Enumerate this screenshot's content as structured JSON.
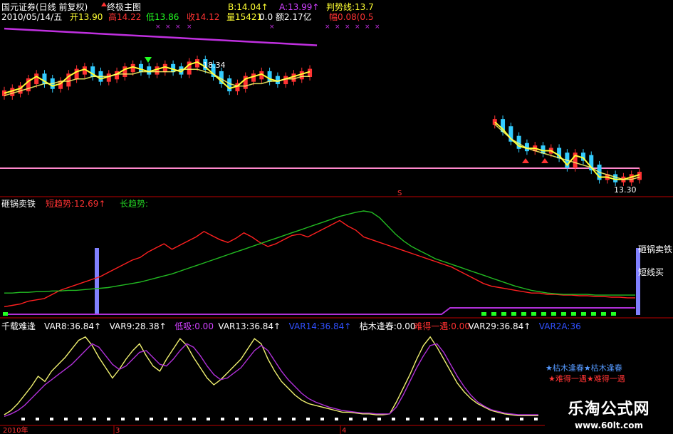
{
  "header": {
    "stock_name": "国元证券(日线 前复权)",
    "date": "2010/05/14/五",
    "main_indicator": "终极主图",
    "b_label": "B:14.04↑",
    "a_label": "A:13.99↑",
    "trend_label": "判势线:13.7",
    "open": "开13.90",
    "high": "高14.22",
    "low": "低13.86",
    "close": "收14.12",
    "volume": "量15421",
    "amount": "0.0 额2.17亿",
    "change": "幅0.08(0.5"
  },
  "colors": {
    "background": "#000000",
    "ma_yellow": "#ffff33",
    "trend_purple": "#c030e0",
    "up_candle": "#ff3333",
    "down_candle": "#33ccff",
    "line_red": "#ff2020",
    "line_green": "#22bb22",
    "line_magenta": "#b030d8",
    "line_yellow": "#f0f070",
    "bar_blue": "#8080ff",
    "square_green": "#22ff22",
    "ref_line": "#ff88cc"
  },
  "price_panel": {
    "high_annotation": "18.34",
    "low_annotation": "13.30",
    "s_marker": "S"
  },
  "panel2": {
    "title": "砸锅卖铁",
    "short_label": "短趋势:12.69↑",
    "long_label": "长趋势:",
    "right_label_1": "砸锅卖铁",
    "right_label_2": "短线买"
  },
  "panel3": {
    "title": "千载难逢",
    "items": [
      {
        "text": "VAR8:36.84↑",
        "color": "#ffffff"
      },
      {
        "text": "VAR9:28.38↑",
        "color": "#ffffff"
      },
      {
        "text": "低吸:0.00",
        "color": "#d040ff"
      },
      {
        "text": "VAR13:36.84↑",
        "color": "#ffffff"
      },
      {
        "text": "VAR14:36.84↑",
        "color": "#3050ff"
      },
      {
        "text": "枯木逢春:0.00",
        "color": "#ffffff"
      },
      {
        "text": "难得一遇:0.00",
        "color": "#ff3030"
      },
      {
        "text": "VAR29:36.84↑",
        "color": "#ffffff"
      },
      {
        "text": "VAR2A:36",
        "color": "#3050ff"
      }
    ],
    "signal_1": "★枯木逢春★枯木逢春",
    "signal_2": "★难得一遇★难得一遇"
  },
  "time_axis": {
    "labels": [
      "2010年",
      "3",
      "4"
    ]
  },
  "watermark": {
    "name": "乐淘公式网",
    "url": "www.60lt.com"
  },
  "chart_data": [
    {
      "type": "line",
      "panel": "price",
      "title": "终极主图",
      "x": [
        0,
        1,
        2,
        3,
        4,
        5,
        6,
        7,
        8,
        9,
        10,
        11,
        12,
        13,
        14,
        15,
        16,
        17,
        18,
        19,
        20,
        21,
        22,
        23,
        24,
        25,
        26,
        27,
        28,
        29,
        30,
        31,
        32,
        33,
        34,
        35,
        36,
        37,
        38,
        39,
        40,
        41,
        42,
        43,
        44,
        45,
        46,
        47,
        48,
        49,
        50,
        51,
        52,
        53,
        54,
        55,
        56,
        57,
        58,
        59,
        60,
        61,
        62,
        63,
        64,
        65,
        66,
        67,
        68,
        69,
        70,
        71,
        72,
        73,
        74,
        75,
        76,
        77,
        78,
        79
      ],
      "series": [
        {
          "name": "B",
          "values": [
            17.2,
            17.3,
            17.4,
            17.7,
            17.9,
            17.7,
            17.5,
            17.6,
            17.9,
            18.1,
            18.2,
            18.0,
            17.8,
            17.9,
            18.0,
            18.2,
            18.3,
            18.2,
            18.1,
            18.2,
            18.3,
            18.2,
            18.1,
            18.4,
            18.5,
            18.3,
            18.0,
            17.7,
            17.4,
            17.5,
            17.8,
            17.9,
            18.0,
            17.8,
            17.7,
            17.8,
            17.9,
            18.0,
            18.1,
            null,
            null,
            null,
            null,
            null,
            null,
            null,
            null,
            null,
            null,
            null,
            null,
            null,
            null,
            null,
            null,
            null,
            null,
            null,
            null,
            null,
            null,
            16.0,
            15.7,
            15.3,
            15.0,
            14.9,
            14.9,
            14.8,
            14.8,
            14.6,
            14.2,
            14.6,
            14.5,
            14.1,
            13.7,
            13.7,
            13.6,
            13.6,
            13.7,
            13.8
          ]
        },
        {
          "name": "判势线",
          "values": [
            17.1,
            17.2,
            17.3,
            17.4,
            17.5,
            17.6,
            17.6,
            17.7,
            17.7,
            17.8,
            17.8,
            17.9,
            17.9,
            17.9,
            18.0,
            18.0,
            18.0,
            18.1,
            18.1,
            18.1,
            18.1,
            18.1,
            18.2,
            18.2,
            18.2,
            18.1,
            18.0,
            17.8,
            17.6,
            17.5,
            17.5,
            17.6,
            17.6,
            17.7,
            17.7,
            17.8,
            17.8,
            17.9,
            17.9,
            null,
            null,
            null,
            null,
            null,
            null,
            null,
            null,
            null,
            null,
            null,
            null,
            null,
            null,
            null,
            null,
            null,
            null,
            null,
            null,
            null,
            null,
            15.9,
            15.6,
            15.3,
            15.1,
            14.9,
            14.8,
            14.7,
            14.6,
            14.5,
            14.4,
            14.3,
            14.2,
            14.1,
            13.9,
            13.8,
            13.7,
            13.6,
            13.6,
            13.7
          ]
        }
      ],
      "trend_line": {
        "start": 19.9,
        "end": 19.2
      }
    },
    {
      "type": "line",
      "panel": "砸锅卖铁",
      "x": [
        0,
        1,
        2,
        3,
        4,
        5,
        6,
        7,
        8,
        9,
        10,
        11,
        12,
        13,
        14,
        15,
        16,
        17,
        18,
        19,
        20,
        21,
        22,
        23,
        24,
        25,
        26,
        27,
        28,
        29,
        30,
        31,
        32,
        33,
        34,
        35,
        36,
        37,
        38,
        39,
        40,
        41,
        42,
        43,
        44,
        45,
        46,
        47,
        48,
        49,
        50,
        51,
        52,
        53,
        54,
        55,
        56,
        57,
        58,
        59,
        60,
        61,
        62,
        63,
        64,
        65,
        66,
        67,
        68,
        69,
        70,
        71,
        72,
        73,
        74,
        75,
        76,
        77,
        78,
        79
      ],
      "series": [
        {
          "name": "短趋势",
          "values": [
            10,
            12,
            14,
            18,
            20,
            22,
            28,
            34,
            38,
            42,
            46,
            50,
            54,
            60,
            66,
            72,
            78,
            82,
            90,
            96,
            102,
            94,
            100,
            106,
            112,
            120,
            114,
            108,
            104,
            110,
            118,
            112,
            104,
            98,
            102,
            108,
            114,
            116,
            112,
            118,
            124,
            130,
            136,
            128,
            122,
            112,
            108,
            104,
            100,
            96,
            92,
            88,
            84,
            80,
            76,
            72,
            68,
            62,
            56,
            50,
            44,
            40,
            38,
            36,
            34,
            32,
            30,
            30,
            28,
            28,
            27,
            27,
            26,
            26,
            25,
            25,
            24,
            24,
            23,
            23
          ]
        },
        {
          "name": "长趋势",
          "values": [
            30,
            30,
            31,
            31,
            32,
            32,
            33,
            33,
            34,
            34,
            35,
            36,
            37,
            38,
            40,
            42,
            44,
            46,
            49,
            52,
            55,
            58,
            62,
            66,
            70,
            74,
            78,
            82,
            86,
            90,
            94,
            98,
            102,
            106,
            110,
            114,
            118,
            122,
            126,
            130,
            134,
            138,
            142,
            145,
            148,
            150,
            148,
            140,
            128,
            116,
            106,
            98,
            92,
            86,
            80,
            76,
            72,
            68,
            64,
            60,
            56,
            52,
            48,
            44,
            40,
            37,
            34,
            32,
            30,
            29,
            28,
            28,
            28,
            28,
            27,
            27,
            27,
            27,
            27,
            27
          ]
        }
      ],
      "ylim": [
        0,
        150
      ]
    },
    {
      "type": "line",
      "panel": "千载难逢",
      "x": [
        0,
        1,
        2,
        3,
        4,
        5,
        6,
        7,
        8,
        9,
        10,
        11,
        12,
        13,
        14,
        15,
        16,
        17,
        18,
        19,
        20,
        21,
        22,
        23,
        24,
        25,
        26,
        27,
        28,
        29,
        30,
        31,
        32,
        33,
        34,
        35,
        36,
        37,
        38,
        39,
        40,
        41,
        42,
        43,
        44,
        45,
        46,
        47,
        48,
        49,
        50,
        51,
        52,
        53,
        54,
        55,
        56,
        57,
        58,
        59,
        60,
        61,
        62,
        63,
        64,
        65,
        66,
        67,
        68,
        69,
        70,
        71,
        72,
        73,
        74,
        75,
        76,
        77,
        78,
        79
      ],
      "series": [
        {
          "name": "VAR8",
          "values": [
            5,
            10,
            18,
            28,
            38,
            50,
            44,
            56,
            64,
            72,
            82,
            92,
            96,
            86,
            72,
            60,
            48,
            58,
            70,
            80,
            88,
            74,
            62,
            56,
            70,
            82,
            94,
            86,
            72,
            60,
            48,
            40,
            46,
            54,
            62,
            70,
            82,
            94,
            88,
            70,
            56,
            44,
            36,
            28,
            22,
            18,
            16,
            14,
            12,
            10,
            8,
            8,
            7,
            6,
            6,
            5,
            5,
            6,
            20,
            36,
            52,
            70,
            86,
            96,
            84,
            70,
            56,
            42,
            32,
            24,
            18,
            14,
            10,
            8,
            6,
            5,
            4,
            4,
            4,
            4
          ]
        },
        {
          "name": "VAR9",
          "values": [
            3,
            6,
            10,
            16,
            24,
            32,
            40,
            46,
            52,
            58,
            64,
            72,
            80,
            88,
            84,
            74,
            64,
            58,
            62,
            70,
            78,
            80,
            72,
            64,
            62,
            70,
            80,
            88,
            84,
            74,
            62,
            52,
            46,
            48,
            54,
            60,
            70,
            80,
            86,
            80,
            68,
            56,
            46,
            38,
            30,
            24,
            20,
            17,
            14,
            12,
            10,
            9,
            8,
            7,
            7,
            6,
            6,
            6,
            14,
            28,
            44,
            60,
            74,
            86,
            88,
            78,
            64,
            50,
            38,
            28,
            20,
            15,
            11,
            9,
            7,
            6,
            5,
            5,
            5,
            5
          ]
        }
      ],
      "ylim": [
        0,
        100
      ]
    }
  ]
}
